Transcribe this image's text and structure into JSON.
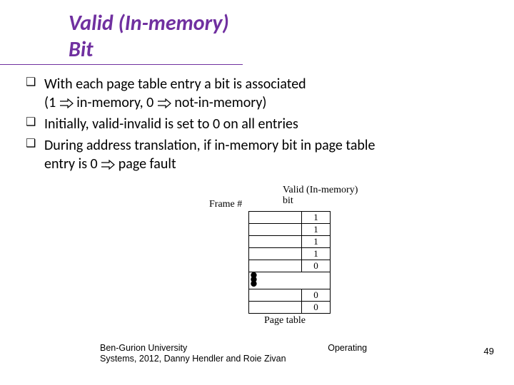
{
  "title": "Valid (In-memory) Bit",
  "bullets": {
    "b1_a": "With each page table entry a bit is associated",
    "b1_b_pre": "(1 ",
    "b1_b_mid": " in-memory, 0 ",
    "b1_b_post": " not-in-memory)",
    "b2": "Initially, valid-invalid is set to 0 on all entries",
    "b3_a": "During address translation, if in-memory bit in page table",
    "b3_b_pre": "entry is 0 ",
    "b3_b_post": " page fault"
  },
  "table": {
    "frame_label": "Frame #",
    "valid_label_l1": "Valid (In-memory)",
    "valid_label_l2": "bit",
    "rows_top": [
      "1",
      "1",
      "1",
      "1",
      "0"
    ],
    "rows_bottom": [
      "0",
      "0"
    ],
    "caption": "Page table"
  },
  "footer_l1": "Ben-Gurion University",
  "footer_mid": "Operating",
  "footer_l2": "Systems, 2012, Danny Hendler and Roie Zivan",
  "page_number": "49"
}
